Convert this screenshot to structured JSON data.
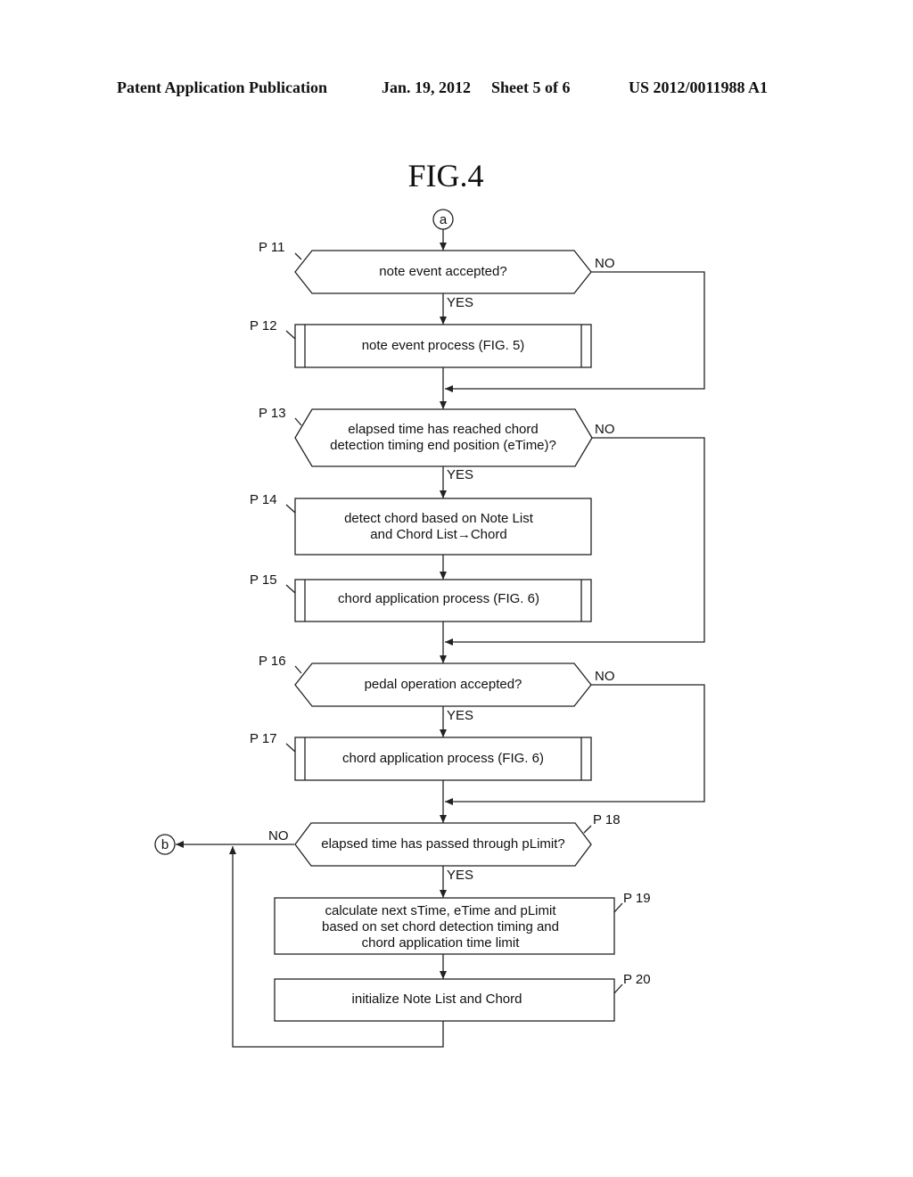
{
  "header": {
    "publication": "Patent Application Publication",
    "date": "Jan. 19, 2012",
    "sheet": "Sheet 5 of 6",
    "number": "US 2012/0011988 A1"
  },
  "figure": {
    "title": "FIG.4",
    "connector_in": "a",
    "connector_out": "b",
    "yes_label": "YES",
    "no_label": "NO",
    "steps": [
      {
        "id": "P 11",
        "type": "decision",
        "lines": [
          "note event accepted?"
        ]
      },
      {
        "id": "P 12",
        "type": "subprocess",
        "lines": [
          "note event process (FIG. 5)"
        ]
      },
      {
        "id": "P 13",
        "type": "decision",
        "lines": [
          "elapsed time has reached chord",
          "detection timing end position (eTime)?"
        ]
      },
      {
        "id": "P 14",
        "type": "process",
        "lines": [
          "detect chord based on Note List",
          "and Chord List→Chord"
        ]
      },
      {
        "id": "P 15",
        "type": "subprocess",
        "lines": [
          "chord application process (FIG. 6)"
        ]
      },
      {
        "id": "P 16",
        "type": "decision",
        "lines": [
          "pedal operation accepted?"
        ]
      },
      {
        "id": "P 17",
        "type": "subprocess",
        "lines": [
          "chord application process (FIG. 6)"
        ]
      },
      {
        "id": "P 18",
        "type": "decision",
        "lines": [
          "elapsed time has passed through pLimit?"
        ]
      },
      {
        "id": "P 19",
        "type": "process",
        "lines": [
          "calculate next sTime, eTime and pLimit",
          "based on set chord detection timing and",
          "chord application time limit"
        ]
      },
      {
        "id": "P 20",
        "type": "process",
        "lines": [
          "initialize Note List and Chord"
        ]
      }
    ]
  }
}
